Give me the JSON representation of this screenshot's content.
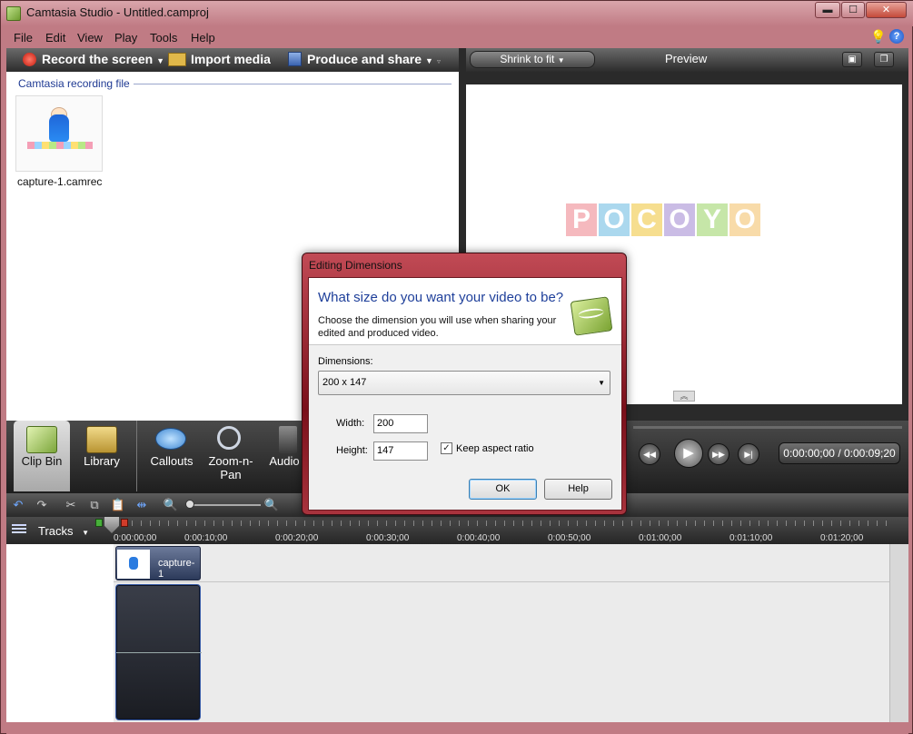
{
  "window": {
    "title": "Camtasia Studio - Untitled.camproj",
    "minimize": "▬",
    "maximize": "☐",
    "close": "✕"
  },
  "menu": [
    "File",
    "Edit",
    "View",
    "Play",
    "Tools",
    "Help"
  ],
  "toolbar": {
    "record": "Record the screen",
    "import": "Import media",
    "produce": "Produce and share"
  },
  "clip_bin": {
    "section_title": "Camtasia recording file",
    "items": [
      {
        "label": "capture-1.camrec"
      }
    ]
  },
  "preview": {
    "zoom_select": "Shrink to fit",
    "label": "Preview",
    "logo_letters": [
      "P",
      "O",
      "C",
      "O",
      "Y",
      "O"
    ]
  },
  "tabs": [
    {
      "label": "Clip Bin",
      "active": true
    },
    {
      "label": "Library"
    },
    {
      "label": "Callouts"
    },
    {
      "label": "Zoom-n-Pan"
    },
    {
      "label": "Audio"
    }
  ],
  "playback": {
    "timecode": "0:00:00;00 / 0:00:09;20"
  },
  "timeline": {
    "tracks_label": "Tracks",
    "ruler": [
      "0:00:00;00",
      "0:00:10;00",
      "0:00:20;00",
      "0:00:30;00",
      "0:00:40;00",
      "0:00:50;00",
      "0:01:00;00",
      "0:01:10;00",
      "0:01:20;00"
    ],
    "clips": [
      {
        "label": "capture-1"
      }
    ]
  },
  "dialog": {
    "title": "Editing Dimensions",
    "question": "What size do you want your video to be?",
    "description": "Choose the dimension you will use when sharing your edited and produced video.",
    "dimensions_label": "Dimensions:",
    "dimensions_value": "200 x 147",
    "width_label": "Width:",
    "width_value": "200",
    "height_label": "Height:",
    "height_value": "147",
    "keep_aspect_label": "Keep aspect ratio",
    "keep_aspect_checked": true,
    "ok": "OK",
    "help": "Help"
  }
}
